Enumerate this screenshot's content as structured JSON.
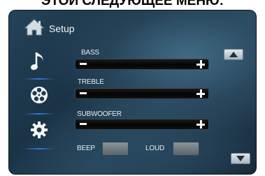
{
  "caption": "ЭТОЙ СЛЕДУЮЩЕЕ МЕНЮ:",
  "header": {
    "title": "Setup",
    "icon": "home-icon"
  },
  "sidebar": {
    "items": [
      {
        "icon": "music-note-icon"
      },
      {
        "icon": "film-reel-icon"
      },
      {
        "icon": "gear-icon"
      }
    ]
  },
  "controls": {
    "bass_label": "BASS",
    "treble_label": "TREBLE",
    "subwoofer_label": "SUBWOOFER",
    "beep_label": "BEEP",
    "loud_label": "LOUD"
  },
  "colors": {
    "background": "#1e3a4e",
    "accent": "#3a78d8",
    "slider_bar": "#0a0a0a"
  }
}
